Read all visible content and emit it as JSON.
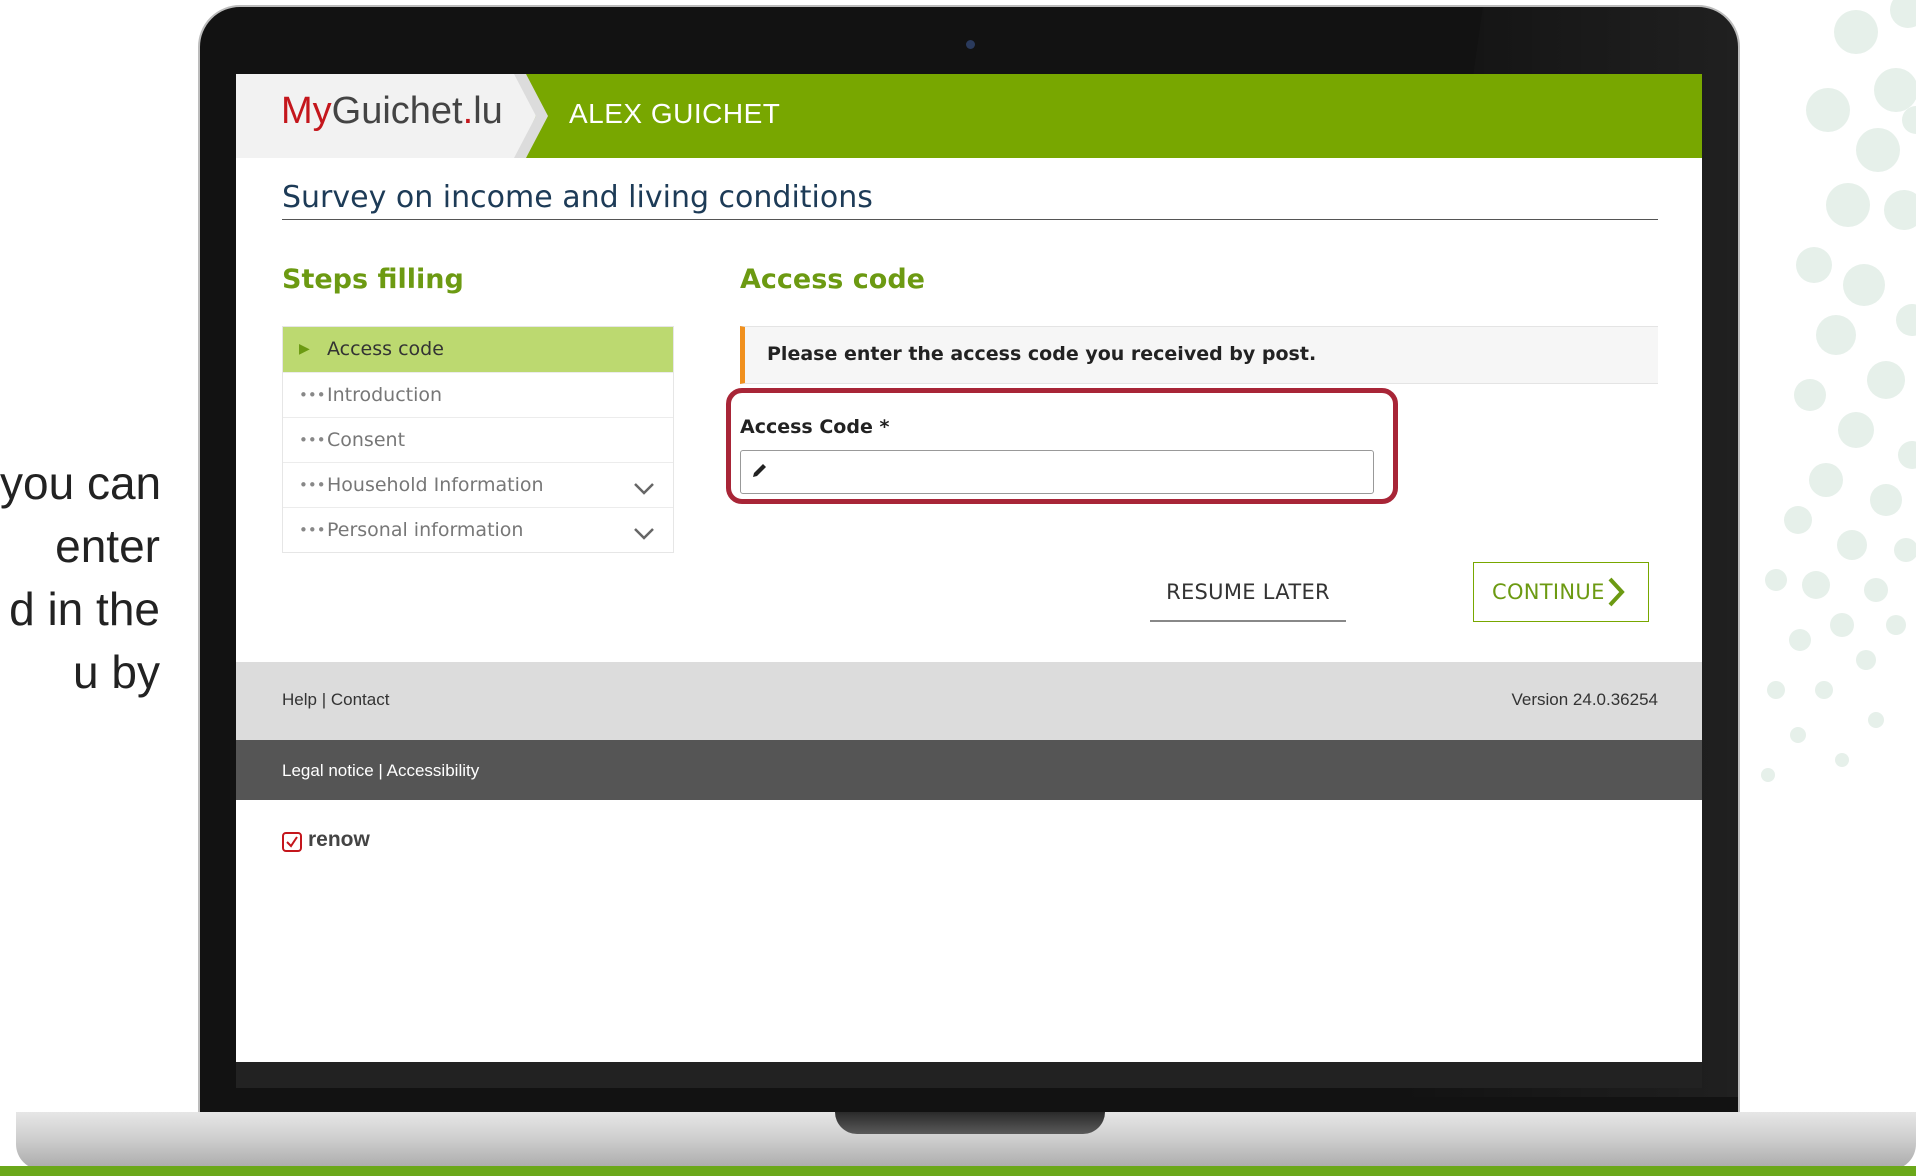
{
  "side_text": [
    "you can",
    "enter",
    "d in the",
    "u by"
  ],
  "app": {
    "logo_part1": "My",
    "logo_part2": "Guichet",
    "logo_dot": ".",
    "logo_part3": "lu",
    "username": "ALEX GUICHET"
  },
  "page": {
    "title": "Survey on income and living conditions"
  },
  "steps": {
    "heading": "Steps filling",
    "items": [
      {
        "label": "Access code",
        "active": true,
        "expandable": false
      },
      {
        "label": "Introduction",
        "active": false,
        "expandable": false
      },
      {
        "label": "Consent",
        "active": false,
        "expandable": false
      },
      {
        "label": "Household Information",
        "active": false,
        "expandable": true
      },
      {
        "label": "Personal information",
        "active": false,
        "expandable": true
      }
    ]
  },
  "main": {
    "heading": "Access code",
    "info": "Please enter the access code you received by post.",
    "field_label": "Access Code  *",
    "field_value": "",
    "field_placeholder": ""
  },
  "actions": {
    "resume_label": "RESUME LATER",
    "continue_label": "CONTINUE"
  },
  "footer": {
    "help": "Help",
    "separator": "|",
    "contact": "Contact",
    "version": "Version 24.0.36254",
    "legal": "Legal notice",
    "accessibility": "Accessibility",
    "brand": "renow"
  },
  "colors": {
    "brand_green": "#78a700",
    "active_step": "#bcd970",
    "info_accent": "#f0901e",
    "highlight": "#a82537",
    "logo_red": "#c4161c"
  },
  "icons": {
    "step_active": "triangle-right-icon",
    "step_pending": "ellipsis-icon",
    "expand": "chevron-down-icon",
    "input": "pencil-icon",
    "continue": "chevron-right-icon",
    "brand": "checkbox-icon"
  }
}
